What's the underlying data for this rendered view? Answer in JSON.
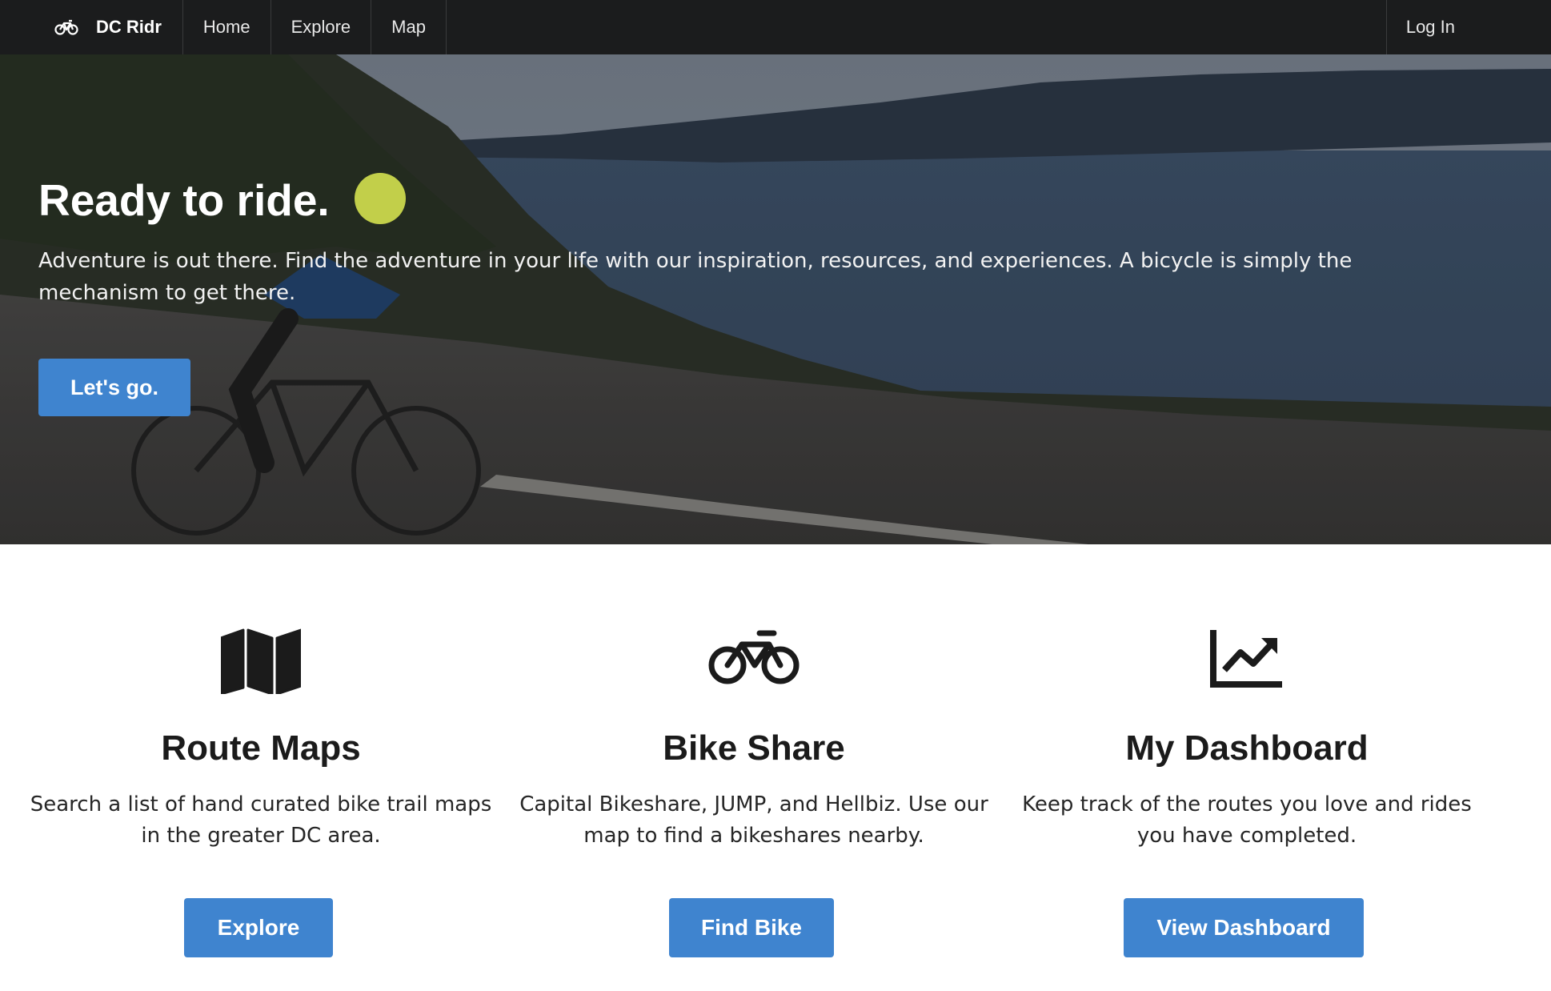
{
  "nav": {
    "brand": "DC Ridr",
    "items": [
      "Home",
      "Explore",
      "Map"
    ],
    "login": "Log In"
  },
  "hero": {
    "title": "Ready to ride.",
    "subtitle": "Adventure is out there. Find the adventure in your life with our inspiration, resources, and experiences. A bicycle is simply the mechanism to get there.",
    "button": "Let's go."
  },
  "features": [
    {
      "icon": "map-icon",
      "title": "Route Maps",
      "text": "Search a list of hand curated bike trail maps in the greater DC area.",
      "button": "Explore"
    },
    {
      "icon": "bicycle-icon",
      "title": "Bike Share",
      "text": "Capital Bikeshare, JUMP, and Hellbiz. Use our map to find a bikeshares nearby.",
      "button": "Find Bike"
    },
    {
      "icon": "chart-line-icon",
      "title": "My Dashboard",
      "text": "Keep track of the routes you love and rides you have completed.",
      "button": "View Dashboard"
    }
  ],
  "colors": {
    "navbar": "#1b1c1d",
    "accent": "#3f84cf"
  }
}
